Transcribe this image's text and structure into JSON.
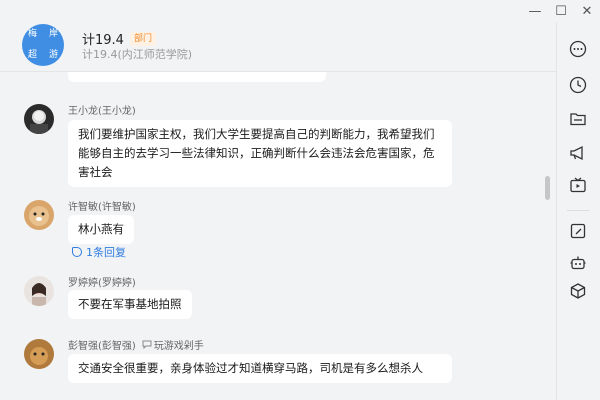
{
  "window": {
    "min_label": "—",
    "max_label": "☐",
    "close_label": "✕"
  },
  "header": {
    "avatar_chars": [
      "梅",
      "岸",
      "超",
      "游"
    ],
    "group_name": "计19.4",
    "dept_tag": "部门",
    "subtitle": "计19.4(内江师范学院)"
  },
  "messages": [
    {
      "sender": "王小龙(王小龙)",
      "text": "我们要维护国家主权，我们大学生要提高自己的判断能力，我希望我们能够自主的去学习一些法律知识，正确判断什么会违法会危害国家，危害社会"
    },
    {
      "sender": "许智敏(许智敏)",
      "text": "林小燕有",
      "reply_count": "1条回复"
    },
    {
      "sender": "罗婷婷(罗婷婷)",
      "text": "不要在军事基地拍照"
    },
    {
      "sender": "彭智强(彭智强)",
      "sender_extra": "玩游戏剁手",
      "text": "交通安全很重要，亲身体验过才知道横穿马路，司机是有多么想杀人"
    }
  ],
  "sidebar": {
    "icons": [
      "more-icon",
      "history-icon",
      "folder-icon",
      "announcement-icon",
      "video-icon",
      "notes-icon",
      "robot-icon",
      "apps-icon"
    ]
  },
  "colors": {
    "accent": "#2f7de1",
    "dept_tag": "#f08a2a",
    "group_avatar": "#3f8ee3"
  }
}
